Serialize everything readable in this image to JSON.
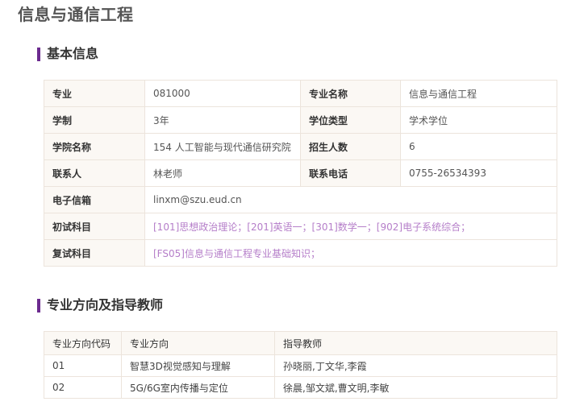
{
  "page_title": "信息与通信工程",
  "sections": {
    "basic": "基本信息",
    "direction": "专业方向及指导教师"
  },
  "basic_info": {
    "major_label": "专业",
    "major_code": "081000",
    "major_name_label": "专业名称",
    "major_name": "信息与通信工程",
    "duration_label": "学制",
    "duration": "3年",
    "degree_type_label": "学位类型",
    "degree_type": "学术学位",
    "college_label": "学院名称",
    "college": "154 人工智能与现代通信研究院",
    "enrollment_label": "招生人数",
    "enrollment": "6",
    "contact_label": "联系人",
    "contact": "林老师",
    "phone_label": "联系电话",
    "phone": "0755-26534393",
    "email_label": "电子信箱",
    "email": "linxm@szu.eud.cn",
    "prelim_label": "初试科目",
    "prelim_subjects": "[101]思想政治理论；[201]英语一；[301]数学一；[902]电子系统综合；",
    "retest_label": "复试科目",
    "retest_subjects": "[FS05]信息与通信工程专业基础知识；"
  },
  "directions": {
    "headers": [
      "专业方向代码",
      "专业方向",
      "指导教师"
    ],
    "rows": [
      {
        "code": "01",
        "name": "智慧3D视觉感知与理解",
        "advisors": "孙晓丽,丁文华,李霞"
      },
      {
        "code": "02",
        "name": "5G/6G室内传播与定位",
        "advisors": "徐晨,邹文斌,曹文明,李敏"
      }
    ]
  },
  "colors": {
    "accent": "#6c2b8f",
    "link": "#b57ec9",
    "label_bg": "#fbf8f4",
    "border": "#ece4dc"
  }
}
